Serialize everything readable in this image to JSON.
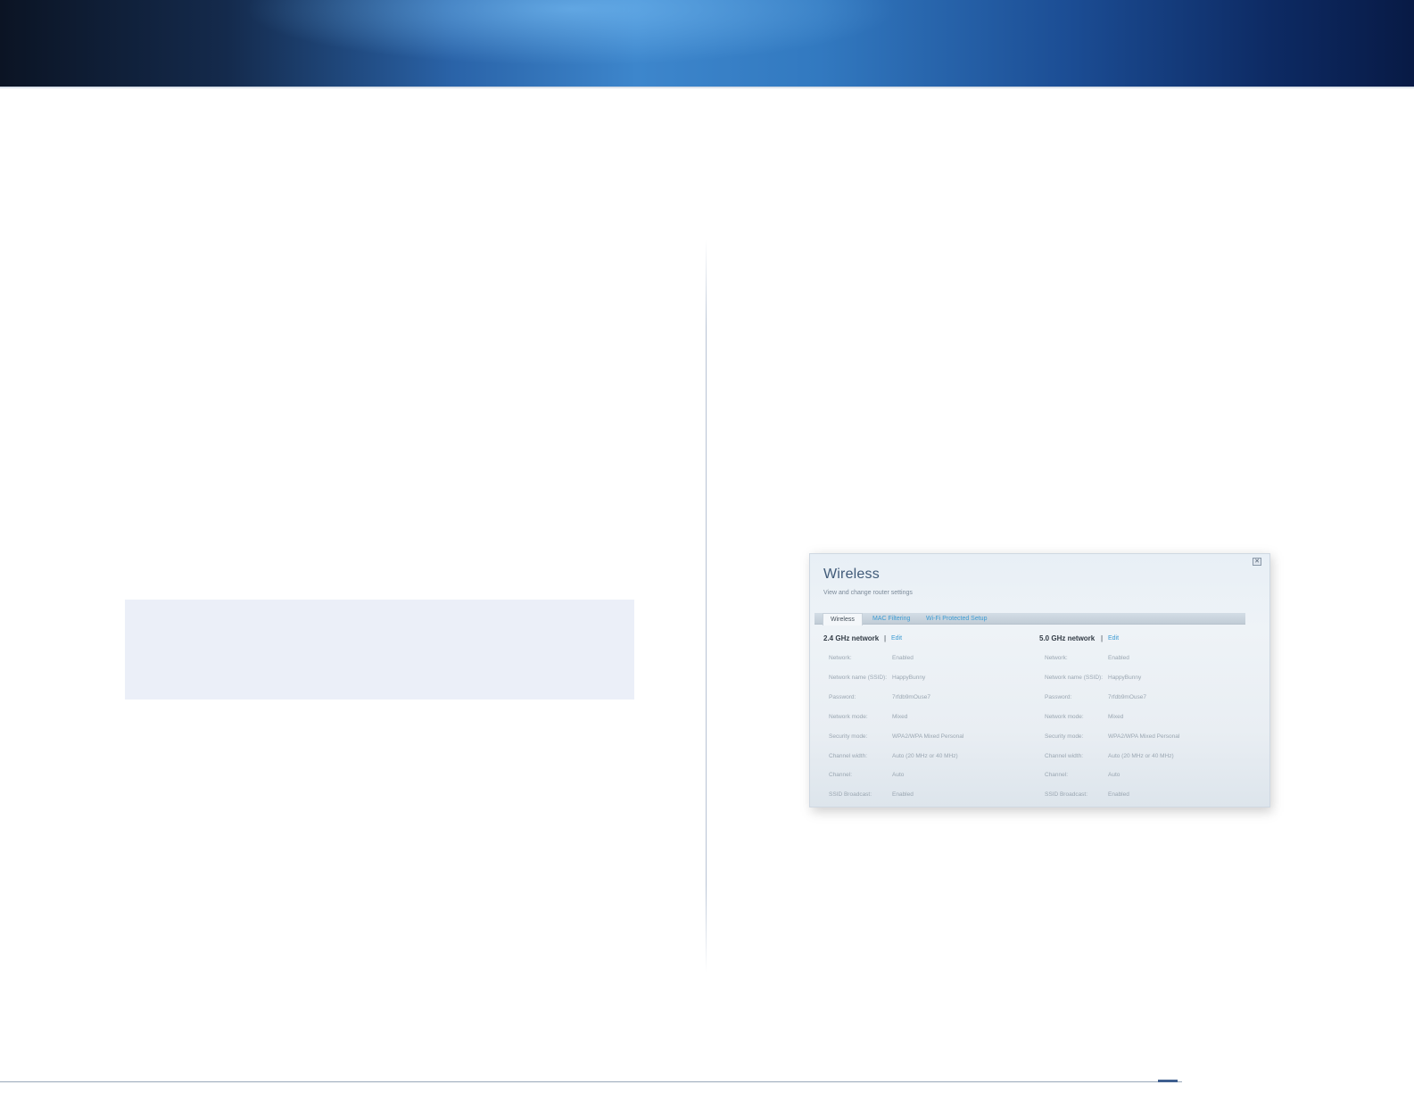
{
  "figure": {
    "title": "Wireless",
    "subtitle": "View and change router settings",
    "close_glyph": "✕",
    "tabs": [
      {
        "label": "Wireless",
        "active": true
      },
      {
        "label": "MAC Filtering",
        "active": false
      },
      {
        "label": "Wi-Fi Protected Setup",
        "active": false
      }
    ],
    "separator": "|",
    "networks": [
      {
        "heading": "2.4 GHz network",
        "edit_label": "Edit",
        "rows": [
          {
            "label": "Network:",
            "value": "Enabled"
          },
          {
            "label": "Network name (SSID):",
            "value": "HappyBunny"
          },
          {
            "label": "Password:",
            "value": "7rfdb9mOuse7"
          },
          {
            "label": "Network mode:",
            "value": "Mixed"
          },
          {
            "label": "Security mode:",
            "value": "WPA2/WPA Mixed Personal"
          },
          {
            "label": "Channel width:",
            "value": "Auto (20 MHz or 40 MHz)"
          },
          {
            "label": "Channel:",
            "value": "Auto"
          },
          {
            "label": "SSID Broadcast:",
            "value": "Enabled"
          }
        ]
      },
      {
        "heading": "5.0 GHz network",
        "edit_label": "Edit",
        "rows": [
          {
            "label": "Network:",
            "value": "Enabled"
          },
          {
            "label": "Network name (SSID):",
            "value": "HappyBunny"
          },
          {
            "label": "Password:",
            "value": "7rfdb9mOuse7"
          },
          {
            "label": "Network mode:",
            "value": "Mixed"
          },
          {
            "label": "Security mode:",
            "value": "WPA2/WPA Mixed Personal"
          },
          {
            "label": "Channel width:",
            "value": "Auto (20 MHz or 40 MHz)"
          },
          {
            "label": "Channel:",
            "value": "Auto"
          },
          {
            "label": "SSID Broadcast:",
            "value": "Enabled"
          }
        ]
      }
    ]
  },
  "colors": {
    "banner_blue": "#3d86cc",
    "note_box_bg": "#ebeff8",
    "link_blue": "#3d9bd2"
  }
}
